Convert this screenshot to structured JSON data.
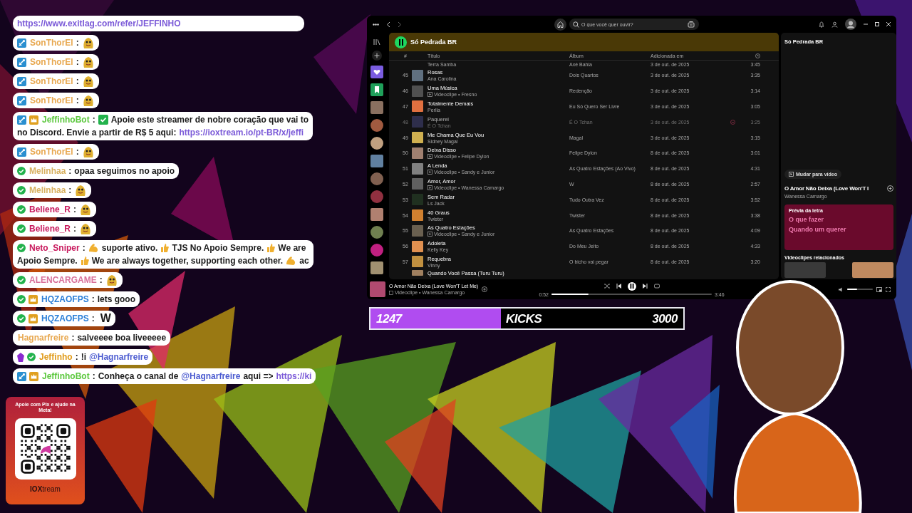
{
  "chat": {
    "pinned_link": "https://www.exitlag.com/refer/JEFFINHO",
    "messages": [
      {
        "badges": [
          {
            "kind": "mod"
          }
        ],
        "user": "SonThorEl",
        "color": "#e8a850",
        "lines": [
          [
            {
              "kind": "text",
              "text": ":"
            },
            {
              "kind": "emote"
            }
          ]
        ]
      },
      {
        "badges": [
          {
            "kind": "mod"
          }
        ],
        "user": "SonThorEl",
        "color": "#e8a850",
        "lines": [
          [
            {
              "kind": "text",
              "text": ":"
            },
            {
              "kind": "emote"
            }
          ]
        ]
      },
      {
        "badges": [
          {
            "kind": "mod"
          }
        ],
        "user": "SonThorEl",
        "color": "#e8a850",
        "lines": [
          [
            {
              "kind": "text",
              "text": ":"
            },
            {
              "kind": "emote"
            }
          ]
        ]
      },
      {
        "badges": [
          {
            "kind": "mod"
          }
        ],
        "user": "SonThorEl",
        "color": "#e8a850",
        "lines": [
          [
            {
              "kind": "text",
              "text": ":"
            },
            {
              "kind": "emote"
            }
          ]
        ]
      },
      {
        "badges": [
          {
            "kind": "mod"
          },
          {
            "kind": "sub"
          }
        ],
        "user": "JeffinhoBot",
        "color": "#5cc83e",
        "lines": [
          [
            {
              "kind": "text",
              "text": ":"
            },
            {
              "kind": "check"
            },
            {
              "kind": "text",
              "text": "Apoie este streamer de nobre coração que vai to"
            }
          ],
          [
            {
              "kind": "text",
              "text": "no Discord. Envie a partir de R$ 5 aqui:"
            },
            {
              "kind": "link",
              "text": "https://ioxtream.io/pt-BR/x/jeffi"
            }
          ]
        ]
      },
      {
        "badges": [
          {
            "kind": "mod"
          }
        ],
        "user": "SonThorEl",
        "color": "#e8a850",
        "lines": [
          [
            {
              "kind": "text",
              "text": ":"
            },
            {
              "kind": "emote"
            }
          ]
        ]
      },
      {
        "badges": [
          {
            "kind": "verified"
          }
        ],
        "user": "Melinhaa",
        "color": "#d8b060",
        "lines": [
          [
            {
              "kind": "text",
              "text": ":"
            },
            {
              "kind": "text",
              "text": "opaa seguimos no apoio"
            }
          ]
        ]
      },
      {
        "badges": [
          {
            "kind": "verified"
          }
        ],
        "user": "Melinhaa",
        "color": "#d8b060",
        "lines": [
          [
            {
              "kind": "text",
              "text": ":"
            },
            {
              "kind": "emote"
            }
          ]
        ]
      },
      {
        "badges": [
          {
            "kind": "verified"
          }
        ],
        "user": "Beliene_R",
        "color": "#c8185c",
        "lines": [
          [
            {
              "kind": "text",
              "text": ":"
            },
            {
              "kind": "emote"
            }
          ]
        ]
      },
      {
        "badges": [
          {
            "kind": "verified"
          }
        ],
        "user": "Beliene_R",
        "color": "#c8185c",
        "lines": [
          [
            {
              "kind": "text",
              "text": ":"
            },
            {
              "kind": "emote"
            }
          ]
        ]
      },
      {
        "badges": [
          {
            "kind": "verified"
          }
        ],
        "user": "Neto_Sniper",
        "color": "#c8185c",
        "lines": [
          [
            {
              "kind": "text",
              "text": ":"
            },
            {
              "kind": "flex"
            },
            {
              "kind": "text",
              "text": "suporte ativo."
            },
            {
              "kind": "thumbs"
            },
            {
              "kind": "text",
              "text": "TJS No Apoio Sempre."
            },
            {
              "kind": "thumbs"
            },
            {
              "kind": "text",
              "text": "We are"
            }
          ],
          [
            {
              "kind": "text",
              "text": "Apoio Sempre."
            },
            {
              "kind": "thumbs"
            },
            {
              "kind": "text",
              "text": "We are always together, supporting each other."
            },
            {
              "kind": "flex"
            },
            {
              "kind": "text",
              "text": "ac"
            }
          ]
        ]
      },
      {
        "badges": [
          {
            "kind": "verified"
          }
        ],
        "user": "ALENCARGAME",
        "color": "#d8709a",
        "lines": [
          [
            {
              "kind": "text",
              "text": ":"
            },
            {
              "kind": "emote"
            }
          ]
        ]
      },
      {
        "badges": [
          {
            "kind": "verified"
          },
          {
            "kind": "sub"
          }
        ],
        "user": "HQZAOFPS",
        "color": "#2b7fd8",
        "lines": [
          [
            {
              "kind": "text",
              "text": ":"
            },
            {
              "kind": "text",
              "text": "lets gooo"
            }
          ]
        ]
      },
      {
        "badges": [
          {
            "kind": "verified"
          },
          {
            "kind": "sub"
          }
        ],
        "user": "HQZAOFPS",
        "color": "#2b7fd8",
        "lines": [
          [
            {
              "kind": "text",
              "text": ":"
            },
            {
              "kind": "big",
              "text": "W"
            }
          ]
        ]
      },
      {
        "user": "Hagnarfreire",
        "color": "#e8a850",
        "lines": [
          [
            {
              "kind": "text",
              "text": ":"
            },
            {
              "kind": "text",
              "text": "salveeee boa liveeeee"
            }
          ]
        ]
      },
      {
        "badges": [
          {
            "kind": "gem"
          },
          {
            "kind": "verified"
          }
        ],
        "user": "Jeffinho",
        "color": "#e09a18",
        "lines": [
          [
            {
              "kind": "text",
              "text": ":"
            },
            {
              "kind": "text",
              "text": "!i"
            },
            {
              "kind": "mention",
              "text": "@Hagnarfreire"
            }
          ]
        ]
      },
      {
        "badges": [
          {
            "kind": "mod"
          },
          {
            "kind": "sub"
          }
        ],
        "user": "JeffinhoBot",
        "color": "#5cc83e",
        "lines": [
          [
            {
              "kind": "text",
              "text": ":"
            },
            {
              "kind": "text",
              "text": "Conheça o canal de"
            },
            {
              "kind": "mention",
              "text": "@Hagnarfreire"
            },
            {
              "kind": "text",
              "text": "aqui =>"
            },
            {
              "kind": "link",
              "text": "https://ki"
            }
          ]
        ]
      }
    ]
  },
  "qr_card": {
    "caption": "Apoie com Pix e ajude na Meta!",
    "logo": "**IOX**tream"
  },
  "spotify": {
    "search": {
      "placeholder": "O que você quer ouvir?"
    },
    "playlist": {
      "title": "Só Pedrada BR",
      "playing": true
    },
    "columns": {
      "number": "#",
      "title": "Título",
      "album": "Álbum",
      "added": "Adicionada em"
    },
    "tracks": [
      {
        "kind": "cut-top",
        "artist": "Terra Samba",
        "album": "Axé Bahia",
        "added": "3 de out. de 2025",
        "duration": "3:45"
      },
      {
        "kind": "full",
        "number": "45",
        "title": "Rosas",
        "artist": "Ana Carolina",
        "video": false,
        "album": "Dois Quartos",
        "added": "3 de out. de 2025",
        "duration": "3:35",
        "disabled": false
      },
      {
        "kind": "full",
        "number": "46",
        "title": "Uma Música",
        "artist": "Videoclipe • Fresno",
        "video": true,
        "album": "Redenção",
        "added": "3 de out. de 2025",
        "duration": "3:14",
        "disabled": false
      },
      {
        "kind": "full",
        "number": "47",
        "title": "Totalmente Demais",
        "artist": "Perlla",
        "video": false,
        "album": "Eu Só Quero Ser Livre",
        "added": "3 de out. de 2025",
        "duration": "3:05",
        "disabled": false
      },
      {
        "kind": "full",
        "number": "48",
        "title": "Paquerei",
        "artist": "É O Tchan",
        "video": false,
        "album": "É O Tchan",
        "added": "3 de out. de 2025",
        "duration": "3:25",
        "disabled": true
      },
      {
        "kind": "full",
        "number": "49",
        "title": "Me Chama Que Eu Vou",
        "artist": "Sidney Magal",
        "video": false,
        "album": "Magal",
        "added": "3 de out. de 2025",
        "duration": "3:15",
        "disabled": false
      },
      {
        "kind": "full",
        "number": "50",
        "title": "Deixa Disso",
        "artist": "Videoclipe • Felipe Dylon",
        "video": true,
        "album": "Felipe Dylon",
        "added": "8 de out. de 2025",
        "duration": "3:01",
        "disabled": false
      },
      {
        "kind": "full",
        "number": "51",
        "title": "A Lenda",
        "artist": "Videoclipe • Sandy e Junior",
        "video": true,
        "album": "As Quatro Estações (Ao Vivo)",
        "added": "8 de out. de 2025",
        "duration": "4:31",
        "disabled": false
      },
      {
        "kind": "full",
        "number": "52",
        "title": "Amor, Amor",
        "artist": "Videoclipe • Wanessa Camargo",
        "video": true,
        "album": "W",
        "added": "8 de out. de 2025",
        "duration": "2:57",
        "disabled": false
      },
      {
        "kind": "full",
        "number": "53",
        "title": "Sem Radar",
        "artist": "Ls Jack",
        "video": false,
        "album": "Tudo Outra Vez",
        "added": "8 de out. de 2025",
        "duration": "3:52",
        "disabled": false
      },
      {
        "kind": "full",
        "number": "54",
        "title": "40 Graus",
        "artist": "Twister",
        "video": false,
        "album": "Twister",
        "added": "8 de out. de 2025",
        "duration": "3:38",
        "disabled": false
      },
      {
        "kind": "full",
        "number": "55",
        "title": "As Quatro Estações",
        "artist": "Videoclipe • Sandy e Junior",
        "video": true,
        "album": "As Quatro Estações",
        "added": "8 de out. de 2025",
        "duration": "4:09",
        "disabled": false
      },
      {
        "kind": "full",
        "number": "56",
        "title": "Adoleta",
        "artist": "Kelly Key",
        "video": false,
        "album": "Do Meu Jeito",
        "added": "8 de out. de 2025",
        "duration": "4:33",
        "disabled": false
      },
      {
        "kind": "full",
        "number": "57",
        "title": "Requebra",
        "artist": "Vinny",
        "video": false,
        "album": "O bicho vai pegar",
        "added": "8 de out. de 2025",
        "duration": "3:20",
        "disabled": false
      },
      {
        "kind": "cut-bottom",
        "title": "Quando Você Passa (Turu Turu)"
      }
    ],
    "side_panel": {
      "title": "Só Pedrada BR",
      "switch_button": "Mudar para vídeo",
      "song": "O Amor Não Deixa (Love Won'T I",
      "artist": "Wanessa Camargo",
      "lyrics_heading": "Prévia da letra",
      "lyrics": [
        "O que fazer",
        "Quando um querer"
      ],
      "related_heading": "Videoclipes relacionados"
    },
    "player": {
      "title": "O Amor Não Deixa (Love Won'T Let Me)",
      "subtitle": "Videoclipe • Wanessa Camargo",
      "video": true,
      "playing": true,
      "elapsed": "0:52",
      "total": "3:46",
      "progress": {
        "level": 0.23
      },
      "volume": {
        "level": 0.4
      }
    }
  },
  "kicks_goal": {
    "current": "1247",
    "label": "KICKS",
    "goal": "3000",
    "level": 0.416
  }
}
